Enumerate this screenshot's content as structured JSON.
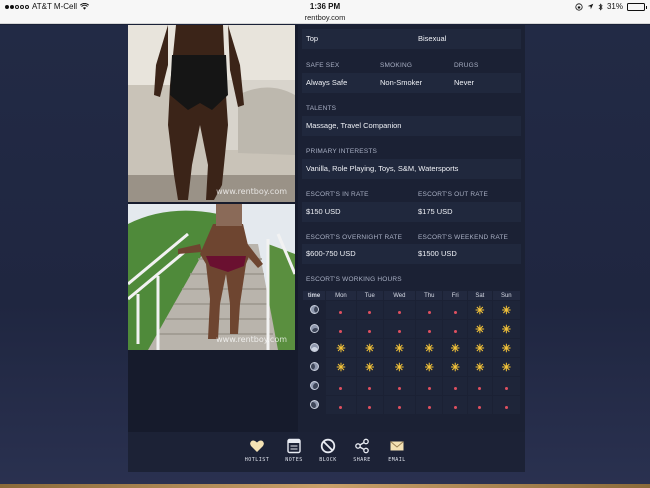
{
  "statusbar": {
    "carrier": "AT&T M-Cell",
    "time": "1:36 PM",
    "url": "rentboy.com",
    "battery": "31%",
    "battery_level": 0.31
  },
  "photos": {
    "watermark": "www.rentboy.com"
  },
  "profile": {
    "position_value": "Top",
    "orientation_value": "Bisexual",
    "safe_sex_label": "SAFE SEX",
    "safe_sex_value": "Always Safe",
    "smoking_label": "SMOKING",
    "smoking_value": "Non-Smoker",
    "drugs_label": "DRUGS",
    "drugs_value": "Never",
    "talents_label": "TALENTS",
    "talents_value": "Massage, Travel Companion",
    "interests_label": "PRIMARY INTERESTS",
    "interests_value": "Vanilla, Role Playing, Toys, S&M, Watersports",
    "in_rate_label": "ESCORT'S IN RATE",
    "in_rate_value": "$150 USD",
    "out_rate_label": "ESCORT'S OUT RATE",
    "out_rate_value": "$175 USD",
    "overnight_label": "ESCORT'S OVERNIGHT RATE",
    "overnight_value": "$600-750 USD",
    "weekend_label": "ESCORT'S WEEKEND RATE",
    "weekend_value": "$1500 USD",
    "hours_label": "ESCORT'S WORKING HOURS"
  },
  "schedule": {
    "time_header": "time",
    "days": [
      "Mon",
      "Tue",
      "Wed",
      "Thu",
      "Fri",
      "Sat",
      "Sun"
    ],
    "rows": [
      {
        "icon": "moon-phase-1-icon",
        "cells": [
          "dot",
          "dot",
          "dot",
          "dot",
          "dot",
          "star",
          "star"
        ]
      },
      {
        "icon": "moon-phase-2-icon",
        "cells": [
          "dot",
          "dot",
          "dot",
          "dot",
          "dot",
          "star",
          "star"
        ]
      },
      {
        "icon": "moon-phase-3-icon",
        "cells": [
          "star",
          "star",
          "star",
          "star",
          "star",
          "star",
          "star"
        ]
      },
      {
        "icon": "moon-phase-4-icon",
        "cells": [
          "star",
          "star",
          "star",
          "star",
          "star",
          "star",
          "star"
        ]
      },
      {
        "icon": "moon-phase-5-icon",
        "cells": [
          "dot",
          "dot",
          "dot",
          "dot",
          "dot",
          "dot",
          "dot"
        ]
      },
      {
        "icon": "moon-phase-6-icon",
        "cells": [
          "dot",
          "dot",
          "dot",
          "dot",
          "dot",
          "dot",
          "dot"
        ]
      }
    ]
  },
  "toolbar": {
    "hotlist": "HOTLIST",
    "notes": "NOTES",
    "block": "BLOCK",
    "share": "SHARE",
    "email": "EMAIL"
  },
  "colors": {
    "accent_star": "#f3c238",
    "unavailable_dot": "#e05060",
    "panel": "#1b2134"
  }
}
